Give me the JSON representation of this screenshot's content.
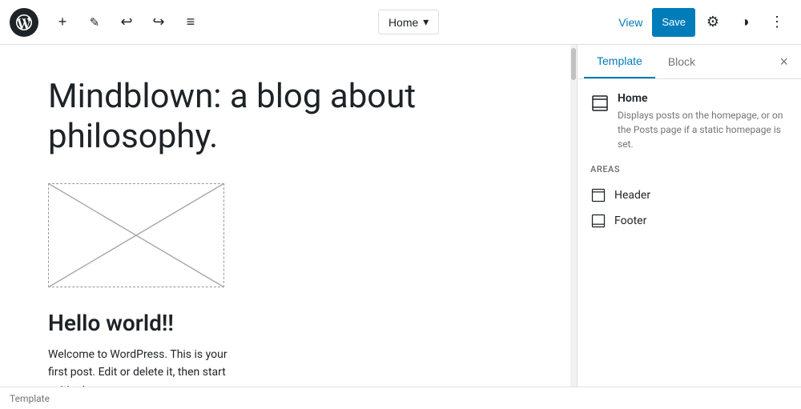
{
  "toolbar": {
    "page_title": "Home",
    "page_dropdown_arrow": "▾",
    "view_label": "View",
    "save_label": "Save",
    "add_icon": "+",
    "pen_icon": "✏",
    "undo_icon": "↩",
    "redo_icon": "↪",
    "list_icon": "≡"
  },
  "editor": {
    "blog_title": "Mindblown: a blog about philosophy.",
    "post_title": "Hello world!!",
    "post_excerpt": "Welcome to WordPress. This is your first post. Edit or delete it, then start writing!"
  },
  "sidebar": {
    "tab_template": "Template",
    "tab_block": "Block",
    "close_label": "×",
    "template_name": "Home",
    "template_desc": "Displays posts on the homepage, or on the Posts page if a static homepage is set.",
    "areas_label": "AREAS",
    "areas": [
      {
        "name": "Header"
      },
      {
        "name": "Footer"
      }
    ]
  },
  "bottom_bar": {
    "label": "Template"
  }
}
